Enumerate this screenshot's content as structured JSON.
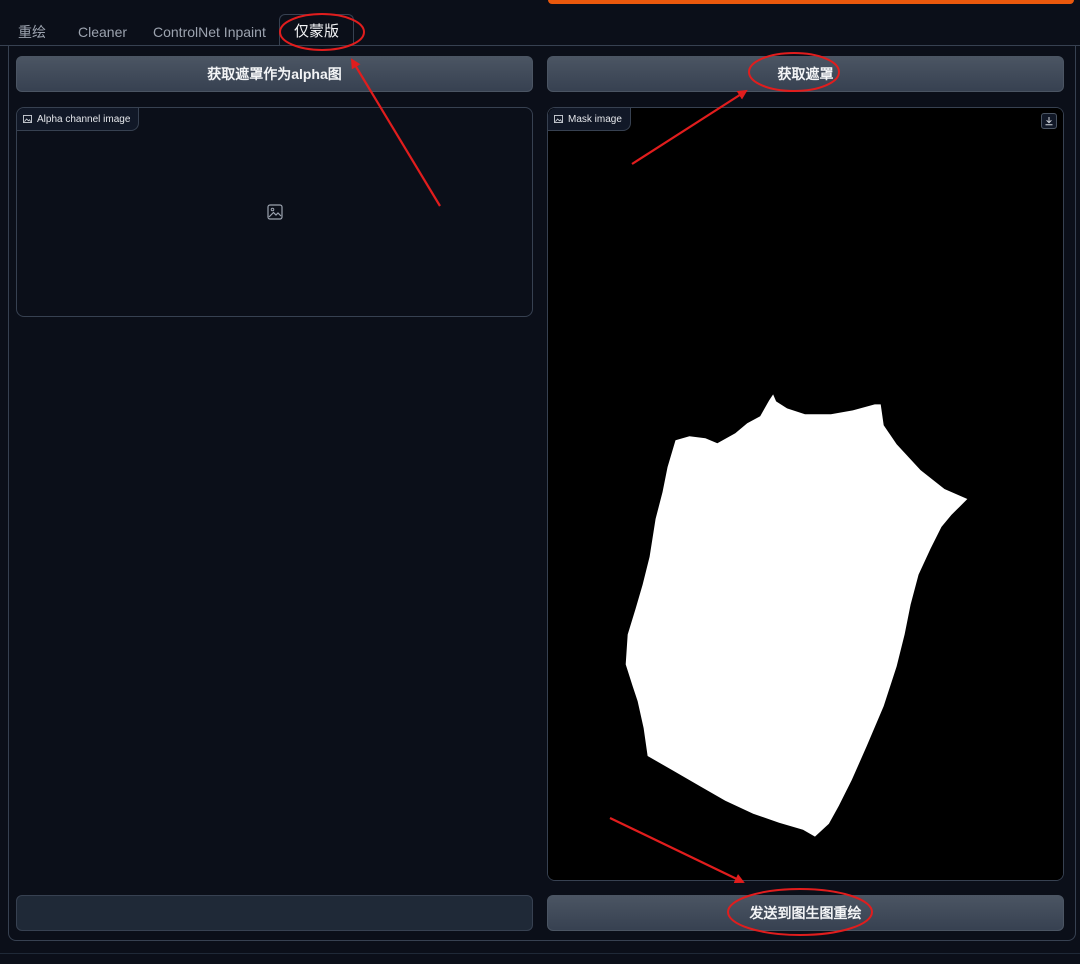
{
  "tabs": [
    {
      "label": "重绘",
      "active": false
    },
    {
      "label": "Cleaner",
      "active": false
    },
    {
      "label": "ControlNet Inpaint",
      "active": false
    },
    {
      "label": "仅蒙版",
      "active": true
    }
  ],
  "left": {
    "button_label": "获取遮罩作为alpha图",
    "image_label": "Alpha channel image",
    "bottom_button_label": ""
  },
  "right": {
    "button_label": "获取遮罩",
    "image_label": "Mask image",
    "bottom_button_label": "发送到图生图重绘"
  },
  "colors": {
    "background": "#0b0f19",
    "accent": "#ea580c",
    "button": "#374151",
    "annotation": "#e11d1d"
  }
}
